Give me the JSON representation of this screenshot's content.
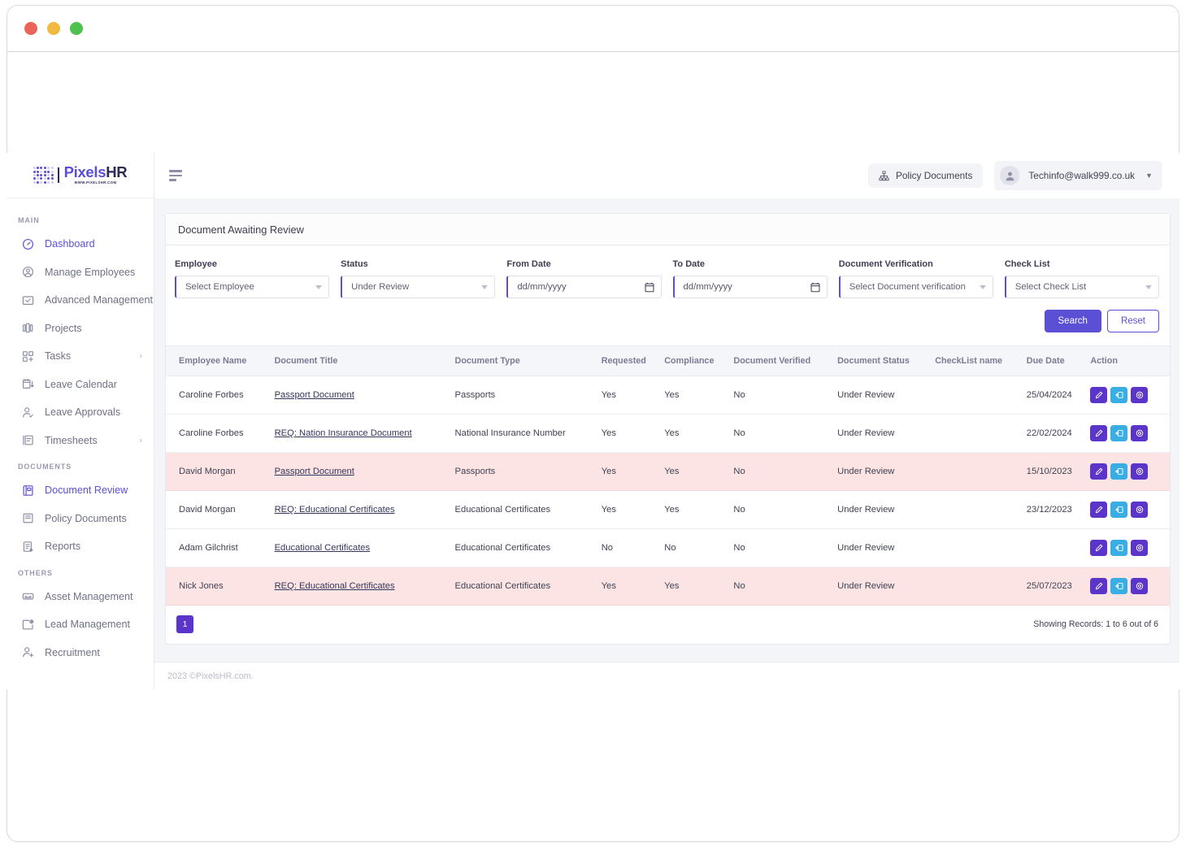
{
  "window": {
    "dots": [
      "close",
      "minimize",
      "maximize"
    ]
  },
  "brand": {
    "name_purple": "Pixels",
    "name_dark": "HR",
    "url": "WWW.PIXELSHR.COM"
  },
  "sidebar": {
    "sections": [
      {
        "label": "MAIN",
        "items": [
          {
            "label": "Dashboard",
            "icon": "dashboard-icon",
            "active": true,
            "chevron": false
          },
          {
            "label": "Manage Employees",
            "icon": "user-circle-icon",
            "active": false,
            "chevron": false
          },
          {
            "label": "Advanced Management",
            "icon": "folder-check-icon",
            "active": false,
            "chevron": false
          },
          {
            "label": "Projects",
            "icon": "projects-icon",
            "active": false,
            "chevron": false
          },
          {
            "label": "Tasks",
            "icon": "tasks-grid-icon",
            "active": false,
            "chevron": true
          },
          {
            "label": "Leave Calendar",
            "icon": "calendar-icon",
            "active": false,
            "chevron": false
          },
          {
            "label": "Leave Approvals",
            "icon": "user-check-icon",
            "active": false,
            "chevron": false
          },
          {
            "label": "Timesheets",
            "icon": "timesheet-icon",
            "active": false,
            "chevron": true
          }
        ]
      },
      {
        "label": "DOCUMENTS",
        "items": [
          {
            "label": "Document Review",
            "icon": "document-review-icon",
            "active": true,
            "chevron": false
          },
          {
            "label": "Policy Documents",
            "icon": "book-icon",
            "active": false,
            "chevron": false
          },
          {
            "label": "Reports",
            "icon": "report-icon",
            "active": false,
            "chevron": false
          }
        ]
      },
      {
        "label": "OTHERS",
        "items": [
          {
            "label": "Asset Management",
            "icon": "asset-icon",
            "active": false,
            "chevron": false
          },
          {
            "label": "Lead Management",
            "icon": "lead-icon",
            "active": false,
            "chevron": false
          },
          {
            "label": "Recruitment",
            "icon": "recruitment-icon",
            "active": false,
            "chevron": false
          }
        ]
      }
    ]
  },
  "topbar": {
    "menu_icon": "hamburger-icon",
    "policy_documents_label": "Policy Documents",
    "policy_documents_icon": "sitemap-icon",
    "user_email": "Techinfo@walk999.co.uk",
    "user_avatar_icon": "user-avatar-icon",
    "user_caret_icon": "chevron-down-icon"
  },
  "card": {
    "title": "Document Awaiting Review"
  },
  "filters": [
    {
      "label": "Employee",
      "value": "Select Employee",
      "type": "select",
      "name": "employee-select"
    },
    {
      "label": "Status",
      "value": "Under Review",
      "type": "select",
      "name": "status-select"
    },
    {
      "label": "From Date",
      "value": "dd/mm/yyyy",
      "type": "date",
      "name": "from-date-input"
    },
    {
      "label": "To Date",
      "value": "dd/mm/yyyy",
      "type": "date",
      "name": "to-date-input"
    },
    {
      "label": "Document Verification",
      "value": "Select Document verification",
      "type": "select",
      "name": "document-verification-select"
    },
    {
      "label": "Check List",
      "value": "Select Check List",
      "type": "select",
      "name": "check-list-select"
    }
  ],
  "buttons": {
    "search": "Search",
    "reset": "Reset"
  },
  "table": {
    "columns": [
      "Employee Name",
      "Document Title",
      "Document Type",
      "Requested",
      "Compliance",
      "Document Verified",
      "Document Status",
      "CheckList name",
      "Due Date",
      "Action"
    ],
    "rows": [
      {
        "employee": "Caroline Forbes",
        "title": "Passport Document",
        "type": "Passports",
        "requested": "Yes",
        "compliance": "Yes",
        "verified": "No",
        "status": "Under Review",
        "checklist": "",
        "due": "25/04/2024",
        "alert": false
      },
      {
        "employee": "Caroline Forbes",
        "title": "REQ: Nation Insurance Document",
        "type": "National Insurance Number",
        "requested": "Yes",
        "compliance": "Yes",
        "verified": "No",
        "status": "Under Review",
        "checklist": "",
        "due": "22/02/2024",
        "alert": false
      },
      {
        "employee": "David Morgan",
        "title": "Passport Document",
        "type": "Passports",
        "requested": "Yes",
        "compliance": "Yes",
        "verified": "No",
        "status": "Under Review",
        "checklist": "",
        "due": "15/10/2023",
        "alert": true
      },
      {
        "employee": "David Morgan",
        "title": "REQ: Educational Certificates",
        "type": "Educational Certificates",
        "requested": "Yes",
        "compliance": "Yes",
        "verified": "No",
        "status": "Under Review",
        "checklist": "",
        "due": "23/12/2023",
        "alert": false
      },
      {
        "employee": "Adam Gilchrist",
        "title": "Educational Certificates",
        "type": "Educational Certificates",
        "requested": "No",
        "compliance": "No",
        "verified": "No",
        "status": "Under Review",
        "checklist": "",
        "due": "",
        "alert": false
      },
      {
        "employee": "Nick Jones",
        "title": "REQ: Educational Certificates",
        "type": "Educational Certificates",
        "requested": "Yes",
        "compliance": "Yes",
        "verified": "No",
        "status": "Under Review",
        "checklist": "",
        "due": "25/07/2023",
        "alert": true
      }
    ],
    "row_actions": [
      {
        "name": "edit-button",
        "icon": "pencil-icon",
        "color": "purple"
      },
      {
        "name": "request-button",
        "icon": "send-document-icon",
        "color": "blue"
      },
      {
        "name": "view-button",
        "icon": "eye-icon",
        "color": "purple"
      }
    ]
  },
  "pagination": {
    "current_page": "1",
    "records_text": "Showing Records: 1 to 6 out of 6"
  },
  "footer": {
    "text": "2023 ©PixelsHR.com."
  },
  "colors": {
    "brand_purple": "#5b4fd6",
    "action_purple": "#5b34c9",
    "action_blue": "#38aee4",
    "alert_row": "#fde4e4",
    "page_bg": "#f4f5f9"
  }
}
